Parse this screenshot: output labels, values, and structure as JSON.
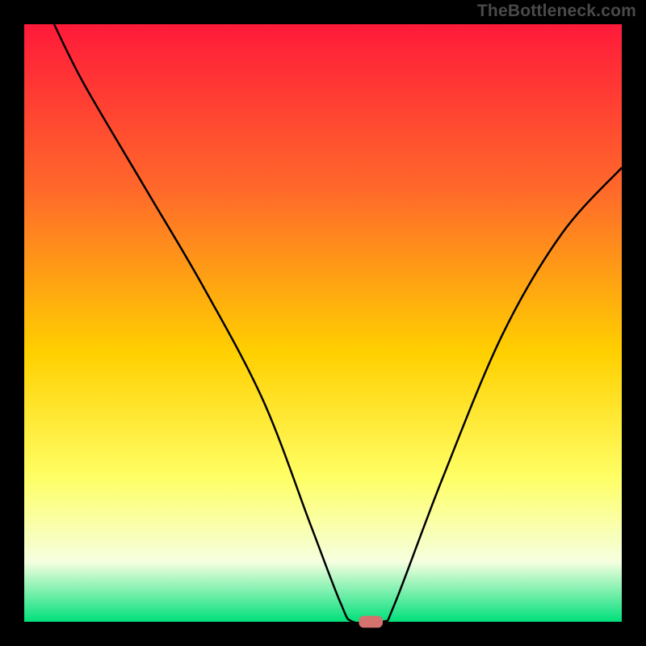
{
  "watermark": "TheBottleneck.com",
  "colors": {
    "gradient_top": "#ff1a3a",
    "gradient_mid1": "#ff6a2a",
    "gradient_mid2": "#ffd000",
    "gradient_mid3": "#ffff66",
    "gradient_mid4": "#f5ffe0",
    "gradient_bottom": "#00e07a",
    "curve": "#000000",
    "marker": "#d4726e",
    "frame": "#000000"
  },
  "chart_data": {
    "type": "line",
    "title": "",
    "xlabel": "",
    "ylabel": "",
    "xlim": [
      0,
      100
    ],
    "ylim": [
      0,
      100
    ],
    "curve_points": [
      {
        "x": 5,
        "y": 100
      },
      {
        "x": 10,
        "y": 90
      },
      {
        "x": 20,
        "y": 73
      },
      {
        "x": 30,
        "y": 56
      },
      {
        "x": 40,
        "y": 37
      },
      {
        "x": 48,
        "y": 16
      },
      {
        "x": 53,
        "y": 3
      },
      {
        "x": 55,
        "y": 0
      },
      {
        "x": 60,
        "y": 0
      },
      {
        "x": 62,
        "y": 3
      },
      {
        "x": 70,
        "y": 24
      },
      {
        "x": 80,
        "y": 48
      },
      {
        "x": 90,
        "y": 65
      },
      {
        "x": 100,
        "y": 76
      }
    ],
    "minimum_marker": {
      "x": 58,
      "y": 0,
      "width": 4,
      "height": 2
    }
  }
}
